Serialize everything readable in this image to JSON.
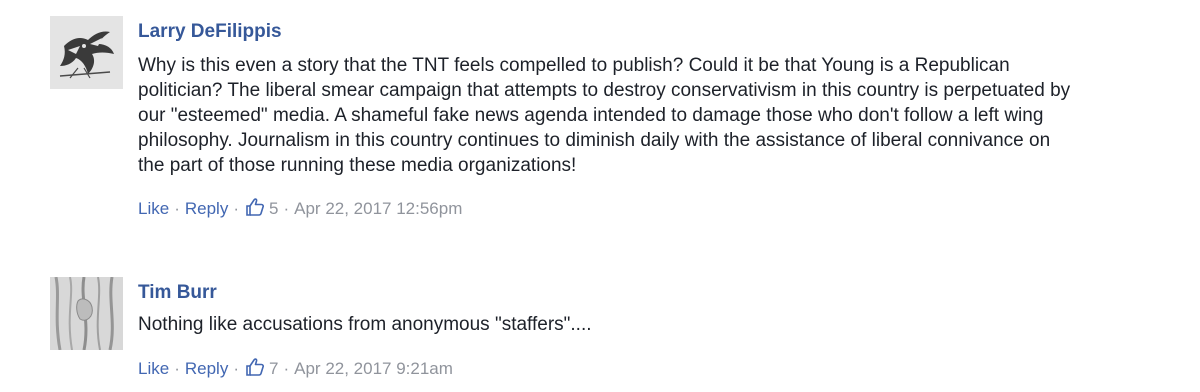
{
  "comments": [
    {
      "author": "Larry DeFilippis",
      "avatar_icon": "bird-sketch-avatar",
      "text": "Why is this even a story that the TNT feels compelled to publish? Could it be that Young is a Republican politician? The liberal smear campaign that attempts to destroy conservativism in this country is perpetuated by our \"esteemed\" media. A shameful fake news agenda intended to damage those who don't follow a left wing philosophy. Journalism in this country continues to diminish daily with the assistance of liberal connivance on the part of those running these media organizations!",
      "like_label": "Like",
      "reply_label": "Reply",
      "separator": "·",
      "like_count": "5",
      "timestamp": "Apr 22, 2017 12:56pm"
    },
    {
      "author": "Tim Burr",
      "avatar_icon": "tree-bark-avatar",
      "text": "Nothing like accusations from anonymous \"staffers\"....",
      "like_label": "Like",
      "reply_label": "Reply",
      "separator": "·",
      "like_count": "7",
      "timestamp": "Apr 22, 2017 9:21am"
    }
  ],
  "colors": {
    "author": "#365899",
    "action_link": "#4267b2",
    "meta": "#90949c",
    "body_text": "#1d2129"
  }
}
